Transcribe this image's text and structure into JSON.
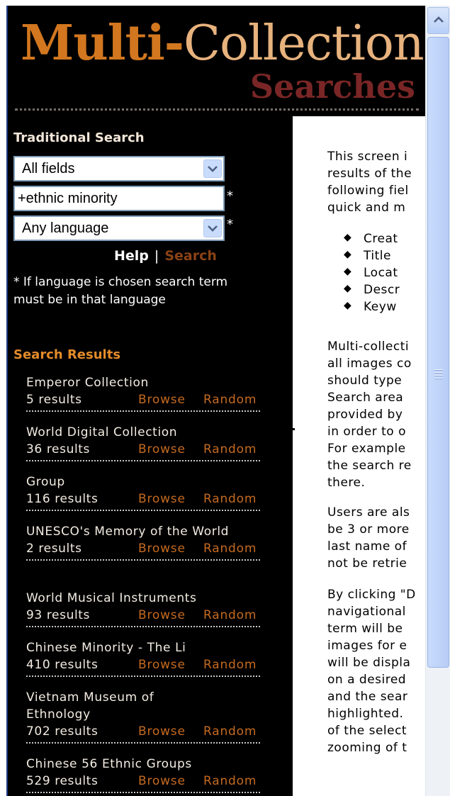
{
  "banner": {
    "title_multi": "Multi-",
    "title_collection": "Collection",
    "subtitle": "Searches"
  },
  "traditional_search": {
    "heading": "Traditional Search",
    "field_select_value": "All fields",
    "query_value": "+ethnic minority",
    "query_required_mark": "*",
    "language_select_value": "Any language",
    "language_required_mark": "*",
    "help_label": "Help",
    "separator": "|",
    "search_label": "Search",
    "note": "* If language is chosen search term must be in that language"
  },
  "search_results": {
    "heading": "Search Results",
    "browse_label": "Browse",
    "random_label": "Random",
    "items": [
      {
        "name": "Emperor Collection",
        "count": "5 results"
      },
      {
        "name": "World Digital Collection",
        "count": "36 results"
      },
      {
        "name": "Group",
        "count": "116 results"
      },
      {
        "name": "UNESCO's Memory of the World",
        "count": "2 results"
      },
      {
        "name": "World Musical Instruments",
        "count": "93 results"
      },
      {
        "name": "Chinese Minority - The Li",
        "count": "410 results"
      },
      {
        "name": "Vietnam Museum of Ethnology",
        "count": "702 results"
      },
      {
        "name": "Chinese 56 Ethnic Groups",
        "count": "529 results"
      }
    ]
  },
  "content": {
    "intro_lines": [
      "This screen i",
      "results of the",
      "following fiel",
      "quick and m"
    ],
    "fields": [
      "Creat",
      "Title",
      "Locat",
      "Descr",
      "Keyw"
    ],
    "para1_lines": [
      "Multi-collecti",
      "all images co",
      "should type",
      "Search area",
      "provided by",
      "in order to o",
      "For example",
      "the search re",
      "there."
    ],
    "para2_lines": [
      "Users are als",
      "be 3 or more",
      "last name of",
      "not be retrie"
    ],
    "para3_lines": [
      "By clicking \"D",
      "navigational",
      "term will be",
      "images for e",
      "will be displa",
      "on a desired",
      "and the sear",
      "highlighted.",
      "of the select",
      "zooming of t"
    ]
  },
  "scrollbar": {
    "up_icon": "chevron-up-icon"
  }
}
